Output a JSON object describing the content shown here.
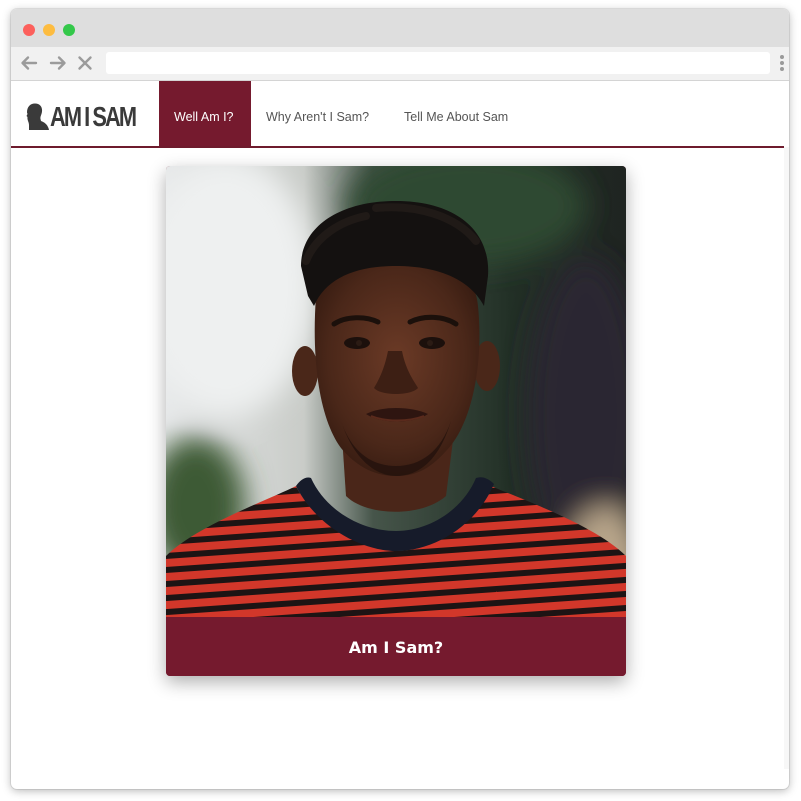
{
  "browser": {
    "buttons": [
      "back-arrow",
      "forward-arrow",
      "stop-x"
    ],
    "url": "",
    "traffic_lights": {
      "close": "#fc605c",
      "minimize": "#fdbc40",
      "zoom": "#34c84a"
    }
  },
  "site": {
    "logo_text": "AM I SAM",
    "nav": [
      {
        "label": "Well Am I?",
        "active": true
      },
      {
        "label": "Why Aren't I Sam?",
        "active": false
      },
      {
        "label": "Tell Me About Sam",
        "active": false
      }
    ],
    "accent_color": "#751a2e"
  },
  "card": {
    "photo": "portrait of young man in red and black striped shirt",
    "button_label": "Am I Sam?"
  }
}
